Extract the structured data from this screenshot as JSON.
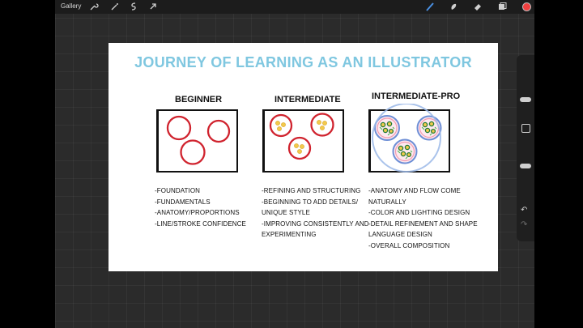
{
  "toolbar": {
    "gallery_label": "Gallery",
    "left_icons": [
      "wrench-icon",
      "magic-wand-icon",
      "selection-icon",
      "transform-arrow-icon"
    ],
    "right_icons": [
      "brush-icon",
      "smudge-icon",
      "eraser-icon",
      "layers-icon"
    ],
    "current_color": "#f04040"
  },
  "sidebar": {
    "icons": [
      "modify-square-icon",
      "undo-icon",
      "redo-icon"
    ],
    "undo_glyph": "↶",
    "redo_glyph": "↷"
  },
  "canvas": {
    "title": "JOURNEY OF LEARNING AS AN ILLUSTRATOR",
    "columns": [
      {
        "heading": "BEGINNER",
        "notes": [
          "-FOUNDATION",
          "-FUNDAMENTALS",
          "-ANATOMY/PROPORTIONS",
          "-LINE/STROKE CONFIDENCE"
        ]
      },
      {
        "heading": "INTERMEDIATE",
        "notes": [
          "-REFINING AND STRUCTURING",
          "-BEGINNING TO ADD DETAILS/",
          "UNIQUE STYLE",
          "-IMPROVING CONSISTENTLY AND",
          "EXPERIMENTING"
        ]
      },
      {
        "heading": "INTERMEDIATE-PRO",
        "notes": [
          "-ANATOMY AND FLOW COME",
          "NATURALLY",
          "-COLOR AND LIGHTING DESIGN",
          "-DETAIL REFINEMENT AND SHAPE",
          "LANGUAGE DESIGN",
          "-OVERALL COMPOSITION"
        ]
      }
    ],
    "colors": {
      "title": "#7fc7e0",
      "circle_red": "#d0232e",
      "dot_yellow": "#f2c94c",
      "blue_stroke": "#6e8fd6",
      "green": "#39b54a",
      "pink": "#f29bb0",
      "selection_ring": "#9bb8e8"
    }
  }
}
